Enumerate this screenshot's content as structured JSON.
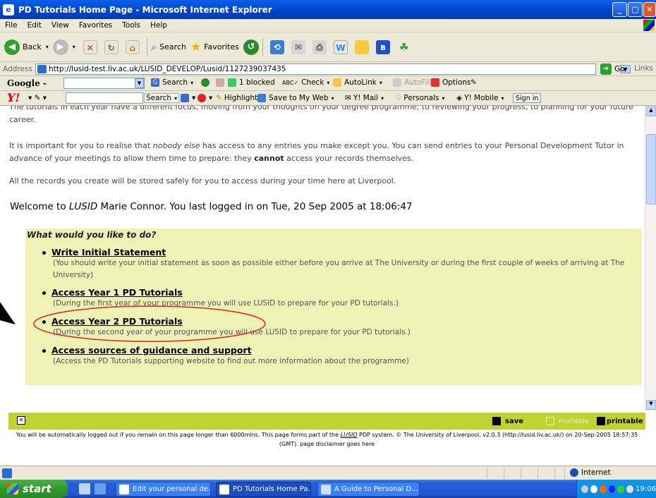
{
  "window": {
    "title": "PD Tutorials Home Page - Microsoft Internet Explorer",
    "icon": "ie-page-icon"
  },
  "menu": [
    "File",
    "Edit",
    "View",
    "Favorites",
    "Tools",
    "Help"
  ],
  "toolbar": {
    "back": "Back",
    "search": "Search",
    "favorites": "Favorites"
  },
  "address": {
    "label": "Address",
    "url": "http://lusid-test.liv.ac.uk/LUSID_DEVELOP/Lusid/1127239037435",
    "go": "Go",
    "links": "Links"
  },
  "google": {
    "logo": "Google -",
    "search": "Search",
    "blocked": "1 blocked",
    "check": "Check",
    "autolink": "AutoLink",
    "autofill": "AutoFill",
    "options": "Options"
  },
  "yahoo": {
    "logo": "Y!",
    "search": "Search",
    "highlight": "Highlight",
    "save_web": "Save to My Web",
    "mail": "Y! Mail",
    "personals": "Personals",
    "mobile": "Y! Mobile",
    "signin": "Sign in"
  },
  "content": {
    "p1": "The tutorials in each year have a different focus, moving from your thoughts on your degree programme, to reviewing your progress, to planning for your future career.",
    "p2_a": "It is important for you to realise that ",
    "p2_em": "nobody else",
    "p2_b": " has access to any entries you make except you. You can send entries to your Personal Development Tutor in advance of your meetings to allow them time to prepare: they ",
    "p2_strong": "cannot",
    "p2_c": " access your records themselves.",
    "p3": "All the records you create will be stored safely for you to access during your time here at Liverpool.",
    "welcome_a": "Welcome to ",
    "welcome_brand": "LUSID",
    "welcome_b": " Marie Connor. You last logged in on Tue, 20 Sep 2005 at 18:06:47",
    "panel_title": "What would you like to do?",
    "options": [
      {
        "label": "Write Initial Statement",
        "desc": "(You should write your initial statement as soon as possible either before you arrive at The University or during the first couple of weeks of arriving at The University)"
      },
      {
        "label": "Access Year 1 PD Tutorials",
        "desc": "(During the first year of your programme you will use LUSID to prepare for your PD tutorials.)"
      },
      {
        "label": "Access Year 2 PD Tutorials",
        "desc": "(During the second year of your programme you will use LUSID to prepare for your PD tutorials.)"
      },
      {
        "label": "Access sources of guidance and support",
        "desc": "(Access the PD Tutorials supporting website to find out more information about the programme)"
      }
    ]
  },
  "footer": {
    "save": "save",
    "mailable": "mailable",
    "printable": "printable",
    "note_a": "You will be automatically logged out if you remain on this page longer than 6000mins. This page forms part of the ",
    "note_link": "LUSID",
    "note_b": " PDP system. © The University of Liverpool. v2.0.3 (http://lusid.liv.ac.uk/) on 20-Sep-2005 18:57:35 (GMT). page disclaimer goes here"
  },
  "status": {
    "zone": "Internet"
  },
  "taskbar": {
    "start": "start",
    "tasks": [
      "Edit your personal de...",
      "PD Tutorials Home Pa...",
      "A Guide to Personal D..."
    ],
    "clock": "19:06"
  },
  "colors": {
    "panel": "#eef2b5",
    "footerbar": "#bfd230",
    "annotation": "#e02020"
  }
}
